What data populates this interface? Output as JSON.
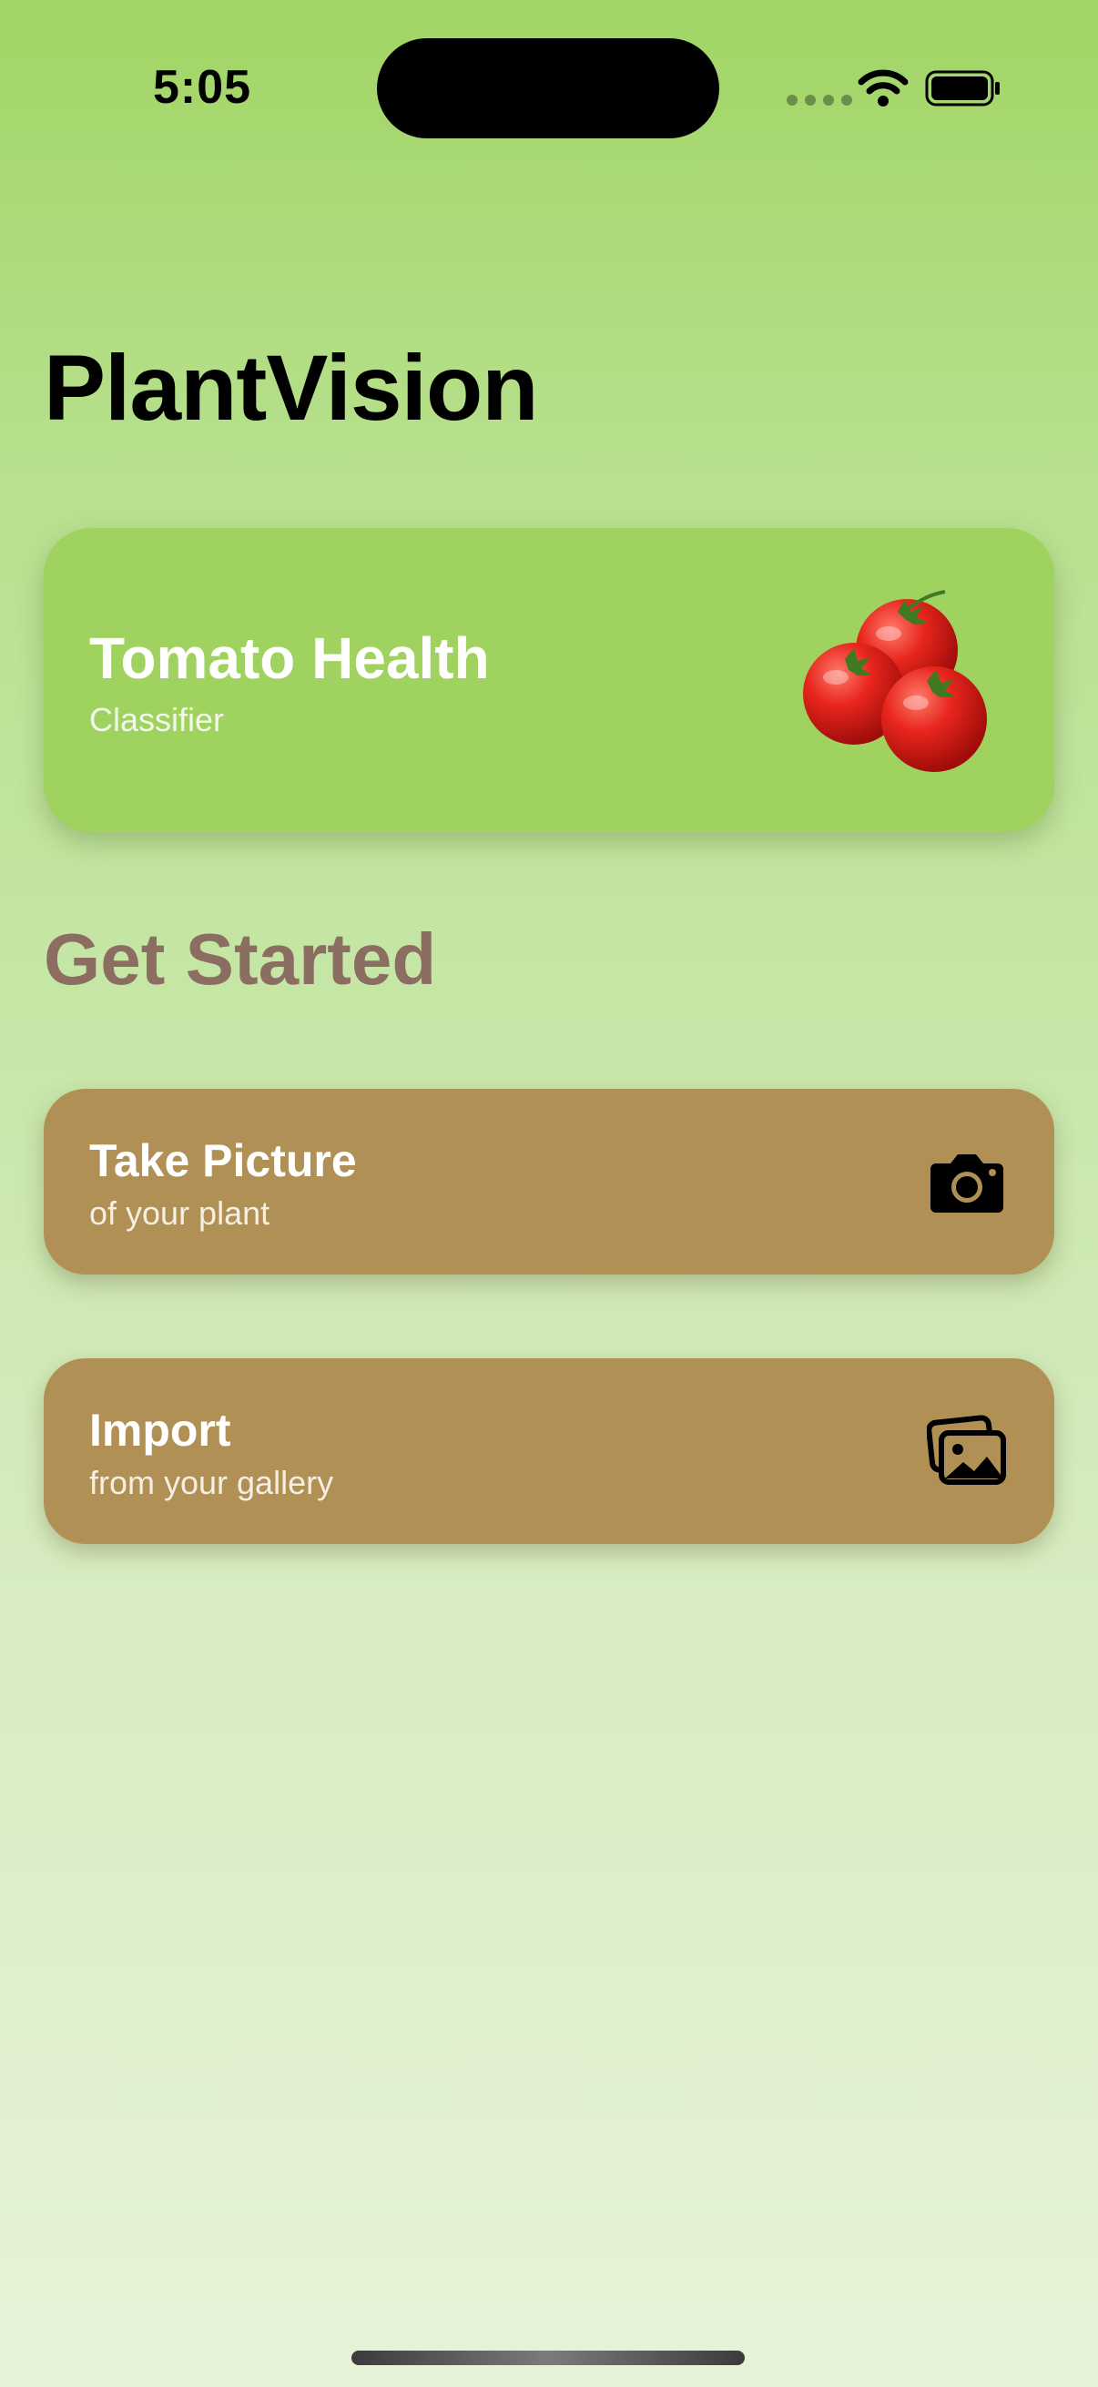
{
  "status_bar": {
    "time": "5:05",
    "icons": [
      "signal-icon",
      "wifi-icon",
      "battery-icon"
    ]
  },
  "app": {
    "title": "PlantVision"
  },
  "hero": {
    "title": "Tomato Health",
    "subtitle": "Classifier",
    "image": "tomato-image"
  },
  "section": {
    "heading": "Get Started"
  },
  "actions": [
    {
      "title": "Take Picture",
      "subtitle": "of your plant",
      "icon": "camera-icon"
    },
    {
      "title": "Import",
      "subtitle": "from your gallery",
      "icon": "photo-gallery-icon"
    }
  ],
  "colors": {
    "background_top": "#a1d565",
    "background_bottom": "#e6f3d9",
    "hero_card": "#9fd25f",
    "action_card": "#b09055",
    "section_heading": "#8c6d62"
  }
}
